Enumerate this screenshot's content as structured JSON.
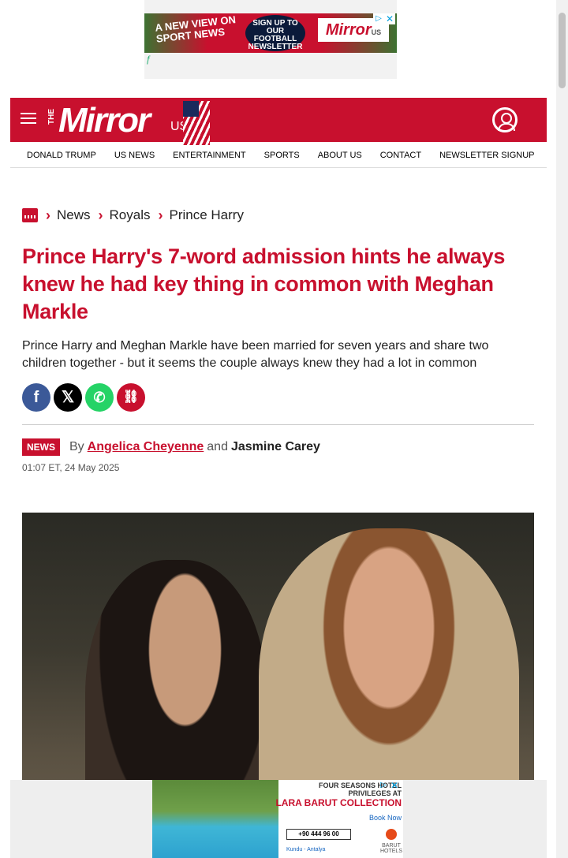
{
  "ad_top": {
    "headline": "A NEW VIEW ON SPORT NEWS",
    "cta": "SIGN UP TO OUR FOOTBALL NEWSLETTER",
    "brand": "Mirror",
    "brand_suffix": "US",
    "close_icon": "close-icon",
    "adchoices_icon": "adchoices-icon",
    "provider_icon": "freestar-icon"
  },
  "masthead": {
    "logo_the": "THE",
    "logo_name": "Mirror",
    "logo_suffix": "US",
    "menu_icon": "hamburger-menu-icon",
    "account_icon": "user-account-icon",
    "bg_color": "#c8102e"
  },
  "nav": {
    "items": [
      "DONALD TRUMP",
      "US NEWS",
      "ENTERTAINMENT",
      "SPORTS",
      "ABOUT US",
      "CONTACT",
      "NEWSLETTER SIGNUP"
    ]
  },
  "breadcrumb": {
    "home_icon": "mirror-home-icon",
    "items": [
      "News",
      "Royals",
      "Prince Harry"
    ]
  },
  "article": {
    "headline": "Prince Harry's 7-word admission hints he always knew he had key thing in common with Meghan Markle",
    "standfirst": "Prince Harry and Meghan Markle have been married for seven years and share two children together - but it seems the couple always knew they had a lot in common",
    "share_icons": [
      "facebook-icon",
      "x-icon",
      "whatsapp-icon",
      "copy-link-icon"
    ],
    "category_badge": "NEWS",
    "by_label": "By",
    "author_1": "Angelica Cheyenne",
    "and_label": "and",
    "author_2": "Jasmine Carey",
    "timestamp": "01:07 ET, 24 May 2025"
  },
  "ad_bottom": {
    "line1": "FOUR SEASONS HOTEL PRIVILEGES AT",
    "line2": "LARA BARUT COLLECTION",
    "line3": "Book Now",
    "phone": "+90 444 96 00",
    "location": "Kundu - Antalya",
    "brand": "BARUT HOTELS"
  },
  "colors": {
    "accent": "#c8102e",
    "facebook": "#3b5998",
    "whatsapp": "#25d366"
  }
}
